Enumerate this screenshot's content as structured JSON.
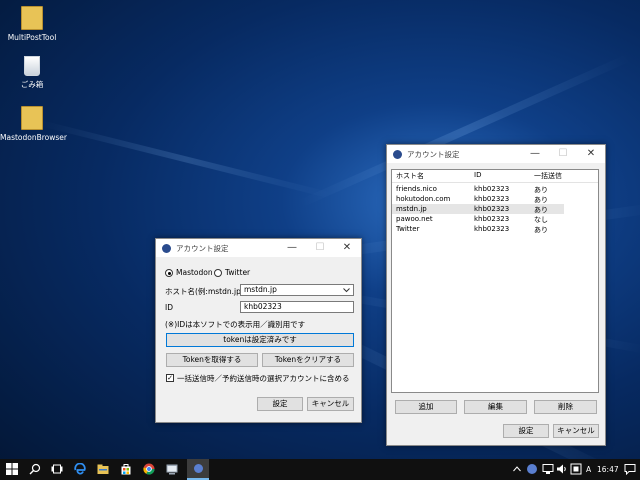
{
  "desktop": {
    "icons": [
      {
        "label": "MultiPostTool"
      },
      {
        "label": "ごみ箱"
      },
      {
        "label": "MastodonBrowser"
      }
    ]
  },
  "dialog_small": {
    "title": "アカウント設定",
    "controls": {
      "minimize": "—",
      "maximize": "☐",
      "close": "✕"
    },
    "radio_mastodon": "Mastodon",
    "radio_twitter": "Twitter",
    "host_label": "ホスト名(例:mstdn.jp)",
    "host_value": "mstdn.jp",
    "id_label": "ID",
    "id_value": "khb02323",
    "note": "(※)IDは本ソフトでの表示用／識別用です",
    "token_status": "tokenは設定済みです",
    "get_token": "Tokenを取得する",
    "clear_token": "Tokenをクリアする",
    "checkbox_label": "一括送信時／予約送信時の選択アカウントに含める",
    "checkbox_checked": "✓",
    "ok": "設定",
    "cancel": "キャンセル"
  },
  "dialog_large": {
    "title": "アカウント設定",
    "controls": {
      "minimize": "—",
      "maximize": "☐",
      "close": "✕"
    },
    "columns": [
      "ホスト名",
      "ID",
      "一括送信"
    ],
    "rows": [
      {
        "host": "friends.nico",
        "id": "khb02323",
        "bulk": "あり"
      },
      {
        "host": "hokutodon.com",
        "id": "khb02323",
        "bulk": "あり"
      },
      {
        "host": "mstdn.jp",
        "id": "khb02323",
        "bulk": "あり"
      },
      {
        "host": "pawoo.net",
        "id": "khb02323",
        "bulk": "なし"
      },
      {
        "host": "Twitter",
        "id": "khb02323",
        "bulk": "あり"
      }
    ],
    "add": "追加",
    "edit": "編集",
    "delete": "削除",
    "ok": "設定",
    "cancel": "キャンセル"
  },
  "taskbar": {
    "time": "16:47",
    "ime": "A"
  }
}
